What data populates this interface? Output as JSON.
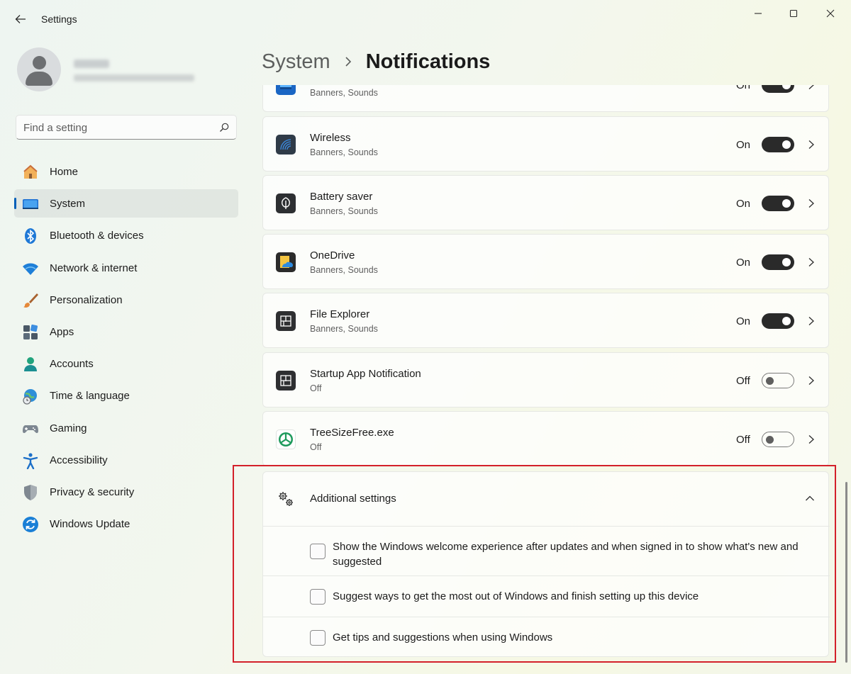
{
  "window": {
    "title": "Settings",
    "controls": {
      "minimize": "minimize",
      "maximize": "maximize",
      "close": "close"
    }
  },
  "user": {
    "name": "",
    "email": ""
  },
  "search": {
    "placeholder": "Find a setting"
  },
  "sidebar": {
    "items": [
      {
        "label": "Home",
        "icon": "home-icon",
        "selected": false
      },
      {
        "label": "System",
        "icon": "system-icon",
        "selected": true
      },
      {
        "label": "Bluetooth & devices",
        "icon": "bluetooth-icon",
        "selected": false
      },
      {
        "label": "Network & internet",
        "icon": "wifi-icon",
        "selected": false
      },
      {
        "label": "Personalization",
        "icon": "paintbrush-icon",
        "selected": false
      },
      {
        "label": "Apps",
        "icon": "apps-icon",
        "selected": false
      },
      {
        "label": "Accounts",
        "icon": "accounts-icon",
        "selected": false
      },
      {
        "label": "Time & language",
        "icon": "globe-clock-icon",
        "selected": false
      },
      {
        "label": "Gaming",
        "icon": "gamepad-icon",
        "selected": false
      },
      {
        "label": "Accessibility",
        "icon": "accessibility-icon",
        "selected": false
      },
      {
        "label": "Privacy & security",
        "icon": "shield-icon",
        "selected": false
      },
      {
        "label": "Windows Update",
        "icon": "update-icon",
        "selected": false
      }
    ]
  },
  "breadcrumb": {
    "parent": "System",
    "current": "Notifications"
  },
  "apps": [
    {
      "name": "",
      "sub": "Banners, Sounds",
      "state": "On",
      "on": true,
      "icon": "app-icon"
    },
    {
      "name": "Wireless",
      "sub": "Banners, Sounds",
      "state": "On",
      "on": true,
      "icon": "wireless-icon"
    },
    {
      "name": "Battery saver",
      "sub": "Banners, Sounds",
      "state": "On",
      "on": true,
      "icon": "battery-saver-icon"
    },
    {
      "name": "OneDrive",
      "sub": "Banners, Sounds",
      "state": "On",
      "on": true,
      "icon": "onedrive-icon"
    },
    {
      "name": "File Explorer",
      "sub": "Banners, Sounds",
      "state": "On",
      "on": true,
      "icon": "file-explorer-icon"
    },
    {
      "name": "Startup App Notification",
      "sub": "Off",
      "state": "Off",
      "on": false,
      "icon": "startup-app-icon"
    },
    {
      "name": "TreeSizeFree.exe",
      "sub": "Off",
      "state": "Off",
      "on": false,
      "icon": "treesize-icon"
    }
  ],
  "additional": {
    "title": "Additional settings",
    "options": [
      {
        "label": "Show the Windows welcome experience after updates and when signed in to show what's new and suggested",
        "checked": false
      },
      {
        "label": "Suggest ways to get the most out of Windows and finish setting up this device",
        "checked": false
      },
      {
        "label": "Get tips and suggestions when using Windows",
        "checked": false
      }
    ]
  },
  "colors": {
    "accent": "#005fb8",
    "toggle_on": "#2a2a2a",
    "highlight_border": "#d3202a"
  }
}
